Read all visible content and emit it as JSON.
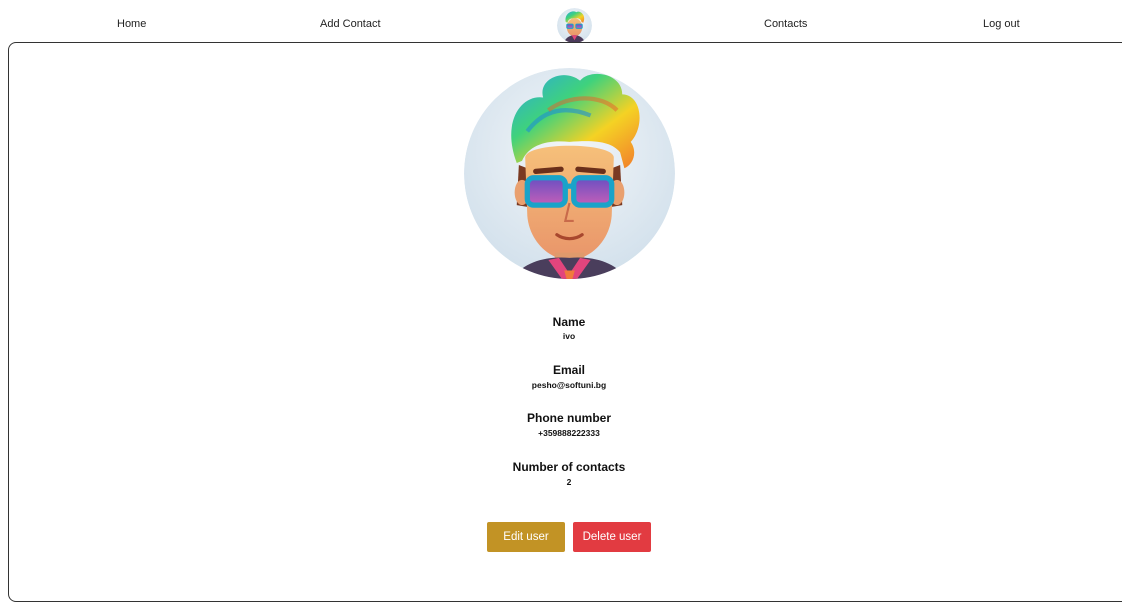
{
  "nav": {
    "home": "Home",
    "add_contact": "Add Contact",
    "contacts": "Contacts",
    "logout": "Log out",
    "avatar_icon": "user-avatar-icon"
  },
  "profile": {
    "avatar_icon": "profile-avatar-icon",
    "fields": [
      {
        "label": "Name",
        "value": "ivo"
      },
      {
        "label": "Email",
        "value": "pesho@softuni.bg"
      },
      {
        "label": "Phone number",
        "value": "+359888222333"
      },
      {
        "label": "Number of contacts",
        "value": "2"
      }
    ]
  },
  "actions": {
    "edit": "Edit user",
    "delete": "Delete user"
  },
  "colors": {
    "edit_button": "#c29325",
    "delete_button": "#e23b41",
    "panel_border": "#333333"
  }
}
